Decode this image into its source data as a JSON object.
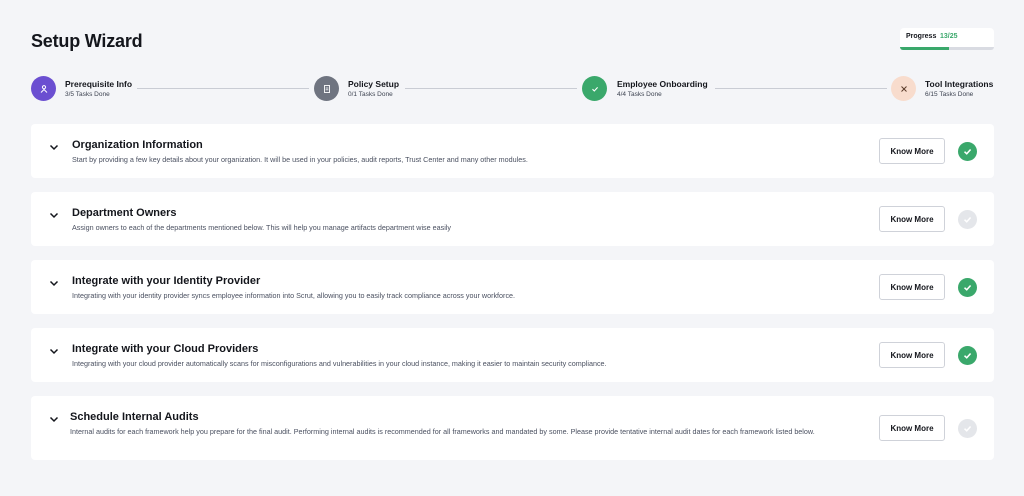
{
  "header": {
    "title": "Setup Wizard"
  },
  "progress": {
    "label": "Progress",
    "count": "13/25",
    "fraction": 0.52
  },
  "steps": [
    {
      "title": "Prerequisite Info",
      "sub": "3/5 Tasks Done",
      "state": "active",
      "icon": "person-icon",
      "color": "#6b4fd1"
    },
    {
      "title": "Policy Setup",
      "sub": "0/1 Tasks Done",
      "state": "pending",
      "icon": "document-icon",
      "color": "#6f7480"
    },
    {
      "title": "Employee Onboarding",
      "sub": "4/4 Tasks Done",
      "state": "complete",
      "icon": "check-icon",
      "color": "#3aa86b"
    },
    {
      "title": "Tool Integrations",
      "sub": "6/15 Tasks Done",
      "state": "pending-light",
      "icon": "tools-icon",
      "color": "#f8dccd"
    }
  ],
  "cards": [
    {
      "title": "Organization Information",
      "desc": "Start by providing a few key details about your organization. It will be used in your policies, audit reports, Trust Center and many other modules.",
      "button": "Know More",
      "done": true
    },
    {
      "title": "Department Owners",
      "desc": "Assign owners to each of the departments mentioned below. This will help you manage artifacts department wise easily",
      "button": "Know More",
      "done": false
    },
    {
      "title": "Integrate with your Identity Provider",
      "desc": "Integrating with your identity provider syncs employee information into Scrut, allowing you to easily track compliance across your workforce.",
      "button": "Know More",
      "done": true
    },
    {
      "title": "Integrate with your Cloud Providers",
      "desc": "Integrating with your cloud provider automatically scans for misconfigurations and vulnerabilities in your cloud instance, making it easier to maintain security compliance.",
      "button": "Know More",
      "done": true
    },
    {
      "title": "Schedule Internal Audits",
      "desc": "Internal audits for each framework help you prepare for the final audit. Performing internal audits is recommended for all frameworks and mandated by some. Please provide tentative internal audit dates for each framework listed below.",
      "button": "Know More",
      "done": false
    }
  ]
}
